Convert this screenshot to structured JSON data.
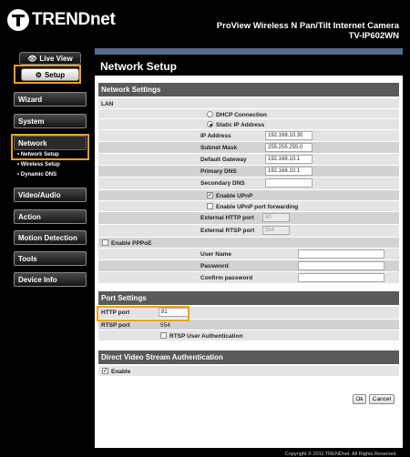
{
  "brand": "TRENDnet",
  "header": {
    "title1": "ProView Wireless N Pan/Tilt Internet Camera",
    "title2": "TV-IP602WN"
  },
  "tabs": {
    "live_view": "Live View",
    "setup": "Setup"
  },
  "menu": {
    "wizard": "Wizard",
    "system": "System",
    "network": "Network",
    "video_audio": "Video/Audio",
    "action": "Action",
    "motion_detection": "Motion Detection",
    "tools": "Tools",
    "device_info": "Device Info",
    "sub": [
      "• Network Setup",
      "• Wireless Setup",
      "• Dynamic DNS"
    ]
  },
  "page_title": "Network Setup",
  "network_settings": {
    "header": "Network Settings",
    "lan": "LAN",
    "dhcp": "DHCP Connection",
    "static_ip": "Static IP Address",
    "ip_label": "IP Address",
    "ip_value": "192.168.10.30",
    "mask_label": "Subnet Mask",
    "mask_value": "255.255.255.0",
    "gateway_label": "Default Gateway",
    "gateway_value": "192.168.10.1",
    "dns1_label": "Primary DNS",
    "dns1_value": "192.168.10.1",
    "dns2_label": "Secondary DNS",
    "dns2_value": "",
    "upnp": "Enable UPnP",
    "upnp_fwd": "Enable UPnP port forwarding",
    "ext_http_label": "External HTTP port",
    "ext_http_value": "80",
    "ext_rtsp_label": "External RTSP port",
    "ext_rtsp_value": "554",
    "pppoe": "Enable PPPoE",
    "user_label": "User Name",
    "pass_label": "Password",
    "confirm_label": "Confirm password"
  },
  "port_settings": {
    "header": "Port Settings",
    "http_label": "HTTP port",
    "http_value": "81",
    "rtsp_label": "RTSP port",
    "rtsp_value": "554",
    "rtsp_auth": "RTSP User Authentication"
  },
  "direct_video": {
    "header": "Direct Video Stream Authentication",
    "enable": "Enable"
  },
  "buttons": {
    "ok": "Ok",
    "cancel": "Cancel"
  },
  "footer": "Copyright © 2011 TRENDnet. All Rights Reserved.",
  "check_mark": "✓"
}
